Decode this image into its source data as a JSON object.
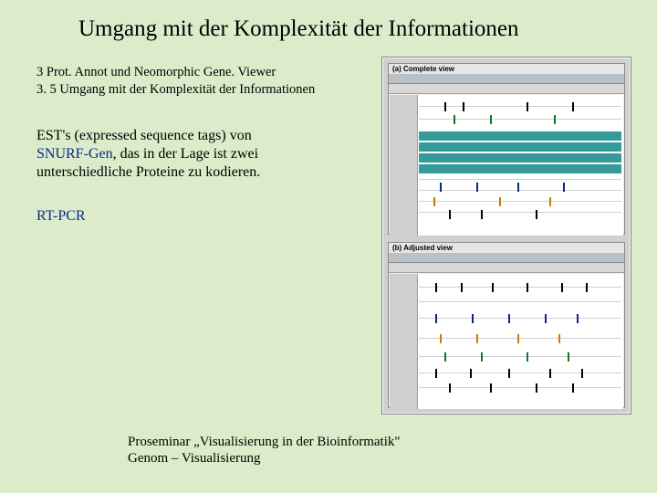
{
  "title": "Umgang mit der Komplexität der Informationen",
  "outline": {
    "l1": "3 Prot. Annot und Neomorphic Gene. Viewer",
    "l2": "3. 5 Umgang mit der Komplexität der Informationen"
  },
  "para": {
    "lead": " EST's (expressed sequence tags) von ",
    "snurf": "SNURF-Gen",
    "tail_line1": ", das in der Lage ist zwei",
    "tail_line2": "unterschiedliche Proteine zu kodieren."
  },
  "rtpcr": "RT-PCR",
  "footer": {
    "l1": "Proseminar „Visualisierung in der Bioinformatik\"",
    "l2": "Genom – Visualisierung"
  },
  "figure": {
    "panel_a_label": "(a) Complete view",
    "panel_b_label": "(b) Adjusted view"
  }
}
